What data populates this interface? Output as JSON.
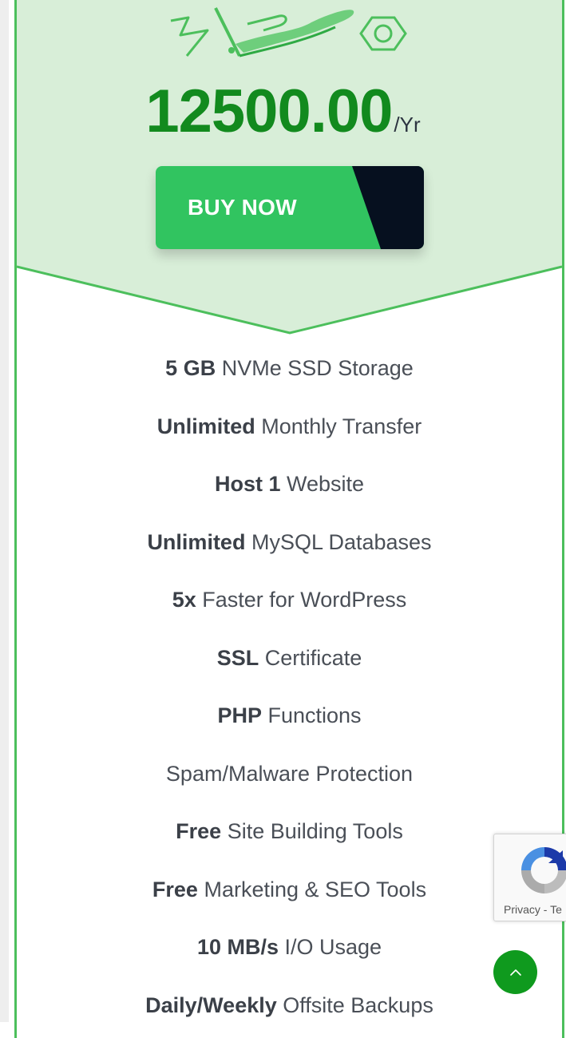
{
  "pricing_card": {
    "price": "12500.00",
    "price_unit": "/Yr",
    "buy_label": "BUY NOW",
    "features": [
      {
        "bold": "5 GB",
        "text": " NVMe SSD Storage"
      },
      {
        "bold": "Unlimited",
        "text": " Monthly Transfer"
      },
      {
        "bold": "Host 1",
        "text": " Website"
      },
      {
        "bold": "Unlimited",
        "text": " MySQL Databases"
      },
      {
        "bold": "5x",
        "text": " Faster for WordPress"
      },
      {
        "bold": "SSL",
        "text": " Certificate"
      },
      {
        "bold": "PHP",
        "text": " Functions"
      },
      {
        "bold": "",
        "text": "Spam/Malware Protection"
      },
      {
        "bold": "Free",
        "text": " Site Building Tools"
      },
      {
        "bold": "Free",
        "text": " Marketing & SEO Tools"
      },
      {
        "bold": "10 MB/s",
        "text": " I/O Usage"
      },
      {
        "bold": "Daily/Weekly",
        "text": " Offsite Backups"
      }
    ]
  },
  "recaptcha": {
    "label": "Privacy - Te"
  },
  "icons": {
    "illustration": "hand-money-illustration-icon",
    "scroll_top": "chevron-up-icon",
    "recaptcha": "recaptcha-logo-icon"
  },
  "colors": {
    "brand_green": "#4cbf5c",
    "price_green": "#128a1e",
    "button_green": "#31c460",
    "button_dark": "#06101f",
    "header_bg": "#d8eed8",
    "scroll_button": "#0f9a1e"
  }
}
